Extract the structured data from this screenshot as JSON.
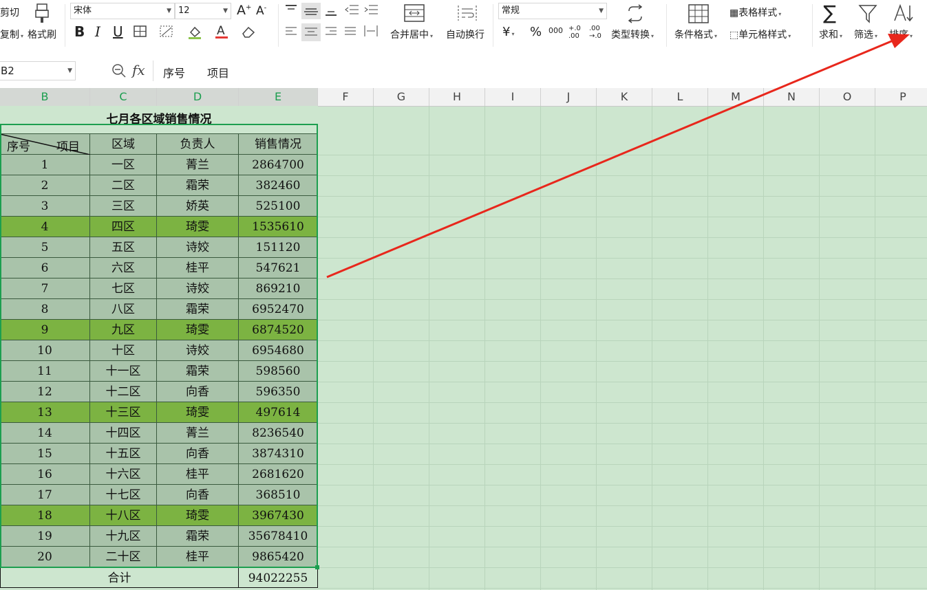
{
  "ribbon": {
    "cut_label": "剪切",
    "copy_label": "复制",
    "format_painter_label": "格式刷",
    "font_name": "宋体",
    "font_size": "12",
    "merge_center_label": "合并居中",
    "wrap_text_label": "自动换行",
    "number_format": "常规",
    "type_convert_label": "类型转换",
    "conditional_format_label": "条件格式",
    "table_style_label": "表格样式",
    "cell_style_label": "单元格样式",
    "sum_label": "求和",
    "filter_label": "筛选",
    "sort_label": "排序",
    "currency_symbol": "¥",
    "percent_symbol": "%",
    "thousands_symbol": "000",
    "inc_decimal": "+.0 .00",
    "dec_decimal": ".00 →.0"
  },
  "formula_bar": {
    "name_box": "B2",
    "fx_label": "fx",
    "content": "序号　　项目"
  },
  "columns": [
    "B",
    "C",
    "D",
    "E",
    "F",
    "G",
    "H",
    "I",
    "J",
    "K",
    "L",
    "M",
    "N",
    "O",
    "P"
  ],
  "table": {
    "title": "七月各区域销售情况",
    "corner_left": "序号",
    "corner_right": "项目",
    "headers": [
      "区域",
      "负责人",
      "销售情况"
    ],
    "rows": [
      {
        "no": "1",
        "region": "一区",
        "owner": "菁兰",
        "sales": "2864700",
        "hi": false
      },
      {
        "no": "2",
        "region": "二区",
        "owner": "霜荣",
        "sales": "382460",
        "hi": false
      },
      {
        "no": "3",
        "region": "三区",
        "owner": "娇英",
        "sales": "525100",
        "hi": false
      },
      {
        "no": "4",
        "region": "四区",
        "owner": "琦雯",
        "sales": "1535610",
        "hi": true
      },
      {
        "no": "5",
        "region": "五区",
        "owner": "诗姣",
        "sales": "151120",
        "hi": false
      },
      {
        "no": "6",
        "region": "六区",
        "owner": "桂平",
        "sales": "547621",
        "hi": false
      },
      {
        "no": "7",
        "region": "七区",
        "owner": "诗姣",
        "sales": "869210",
        "hi": false
      },
      {
        "no": "8",
        "region": "八区",
        "owner": "霜荣",
        "sales": "6952470",
        "hi": false
      },
      {
        "no": "9",
        "region": "九区",
        "owner": "琦雯",
        "sales": "6874520",
        "hi": true
      },
      {
        "no": "10",
        "region": "十区",
        "owner": "诗姣",
        "sales": "6954680",
        "hi": false
      },
      {
        "no": "11",
        "region": "十一区",
        "owner": "霜荣",
        "sales": "598560",
        "hi": false
      },
      {
        "no": "12",
        "region": "十二区",
        "owner": "向香",
        "sales": "596350",
        "hi": false
      },
      {
        "no": "13",
        "region": "十三区",
        "owner": "琦雯",
        "sales": "497614",
        "hi": true
      },
      {
        "no": "14",
        "region": "十四区",
        "owner": "菁兰",
        "sales": "8236540",
        "hi": false
      },
      {
        "no": "15",
        "region": "十五区",
        "owner": "向香",
        "sales": "3874310",
        "hi": false
      },
      {
        "no": "16",
        "region": "十六区",
        "owner": "桂平",
        "sales": "2681620",
        "hi": false
      },
      {
        "no": "17",
        "region": "十七区",
        "owner": "向香",
        "sales": "368510",
        "hi": false
      },
      {
        "no": "18",
        "region": "十八区",
        "owner": "琦雯",
        "sales": "3967430",
        "hi": true
      },
      {
        "no": "19",
        "region": "十九区",
        "owner": "霜荣",
        "sales": "35678410",
        "hi": false
      },
      {
        "no": "20",
        "region": "二十区",
        "owner": "桂平",
        "sales": "9865420",
        "hi": false
      }
    ],
    "total_label": "合计",
    "total_value": "94022255"
  },
  "colors": {
    "sheet_bg": "#cde6cf",
    "row_normal": "#a9c3aa",
    "row_highlight": "#7cb342",
    "arrow": "#e8271c",
    "selection": "#1c9e4f"
  }
}
